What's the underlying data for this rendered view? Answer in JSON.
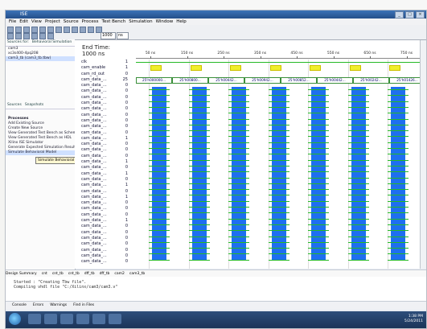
{
  "window": {
    "title": "ISE",
    "menu": [
      "File",
      "Edit",
      "View",
      "Project",
      "Source",
      "Process",
      "Test Bench",
      "Simulation",
      "Window",
      "Help"
    ]
  },
  "toolbar": {
    "time_field": "1000",
    "unit_field": "ns"
  },
  "left_panel": {
    "tabs": [
      "Sources for:",
      "Behavioral Simulation"
    ],
    "items": [
      "cam3",
      "xc3s400-4pq208",
      "cam3_tb (cam3_tb.tbw)"
    ],
    "process_tabs": [
      "Sources",
      "Snapshots"
    ],
    "process_label": "Processes",
    "process_items": [
      "Add Existing Source",
      "Create New Source",
      "View Generated Test Bench as Schematic",
      "View Generated Test Bench as HDL",
      "Xilinx ISE Simulator",
      "Generate Expected Simulation Results",
      "Simulate Behavioral Model"
    ],
    "tooltip": "Simulate Behavioral Model"
  },
  "waveform": {
    "end_time_label": "End Time:",
    "end_time_value": "1000 ns",
    "timeline_labels": [
      "50 ns",
      "150 ns",
      "250 ns",
      "350 ns",
      "450 ns",
      "550 ns",
      "650 ns",
      "750 ns",
      "850 ns"
    ],
    "signals": [
      {
        "name": "clk",
        "value": "1"
      },
      {
        "name": "cam_enable",
        "value": "1"
      },
      {
        "name": "cam_rd_out",
        "value": "0"
      },
      {
        "name": "cam_data_...",
        "value": "25"
      },
      {
        "name": "cam_data_...",
        "value": "0"
      },
      {
        "name": "cam_data_...",
        "value": "0"
      },
      {
        "name": "cam_data_...",
        "value": "0"
      },
      {
        "name": "cam_data_...",
        "value": "0"
      },
      {
        "name": "cam_data_...",
        "value": "0"
      },
      {
        "name": "cam_data_...",
        "value": "0"
      },
      {
        "name": "cam_data_...",
        "value": "0"
      },
      {
        "name": "cam_data_...",
        "value": "0"
      },
      {
        "name": "cam_data_...",
        "value": "0"
      },
      {
        "name": "cam_data_...",
        "value": "1"
      },
      {
        "name": "cam_data_...",
        "value": "0"
      },
      {
        "name": "cam_data_...",
        "value": "0"
      },
      {
        "name": "cam_data_...",
        "value": "0"
      },
      {
        "name": "cam_data_...",
        "value": "1"
      },
      {
        "name": "cam_data_...",
        "value": "0"
      },
      {
        "name": "cam_data_...",
        "value": "1"
      },
      {
        "name": "cam_data_...",
        "value": "0"
      },
      {
        "name": "cam_data_...",
        "value": "1"
      },
      {
        "name": "cam_data_...",
        "value": "0"
      },
      {
        "name": "cam_data_...",
        "value": "1"
      },
      {
        "name": "cam_data_...",
        "value": "0"
      },
      {
        "name": "cam_data_...",
        "value": "0"
      },
      {
        "name": "cam_data_...",
        "value": "0"
      },
      {
        "name": "cam_data_...",
        "value": "1"
      },
      {
        "name": "cam_data_...",
        "value": "0"
      },
      {
        "name": "cam_data_...",
        "value": "0"
      },
      {
        "name": "cam_data_...",
        "value": "0"
      },
      {
        "name": "cam_data_...",
        "value": "0"
      },
      {
        "name": "cam_data_...",
        "value": "0"
      },
      {
        "name": "cam_data_...",
        "value": "0"
      },
      {
        "name": "cam_data_...",
        "value": "0"
      }
    ],
    "bus_labels": [
      "25'h000000...",
      "25'h00800...",
      "25'h00442...",
      "25'h00942...",
      "25'h00852...",
      "25'h00442...",
      "25'h00242...",
      "25'h01426...",
      "25'h0000000000..."
    ]
  },
  "bottom_tabs": [
    "Design Summary",
    "cnt",
    "cnt_tb",
    "cnt_tb",
    "dff_tb",
    "dff_tb",
    "cam2",
    "cam3_tb"
  ],
  "console": {
    "lines": [
      "Started : \"Creating Tbw file\".",
      "Compiling vhdl file \"C:/Xilinx/cam3/cam3.v\""
    ],
    "tabs": [
      "Console",
      "Errors",
      "Warnings",
      "Find in Files"
    ]
  },
  "taskbar": {
    "clock_time": "1:38 PM",
    "clock_date": "5/24/2011"
  }
}
